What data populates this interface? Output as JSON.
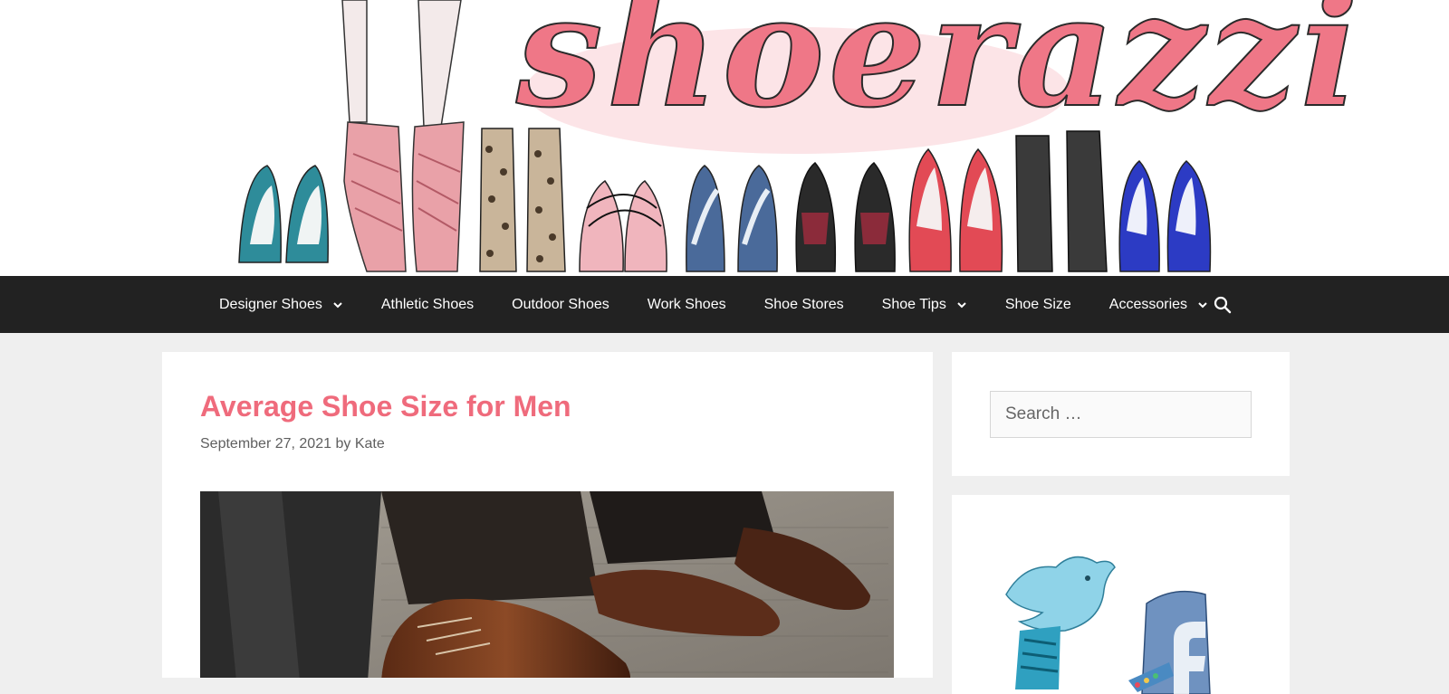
{
  "brand": {
    "logo_text": "shoerazzi",
    "accent_color": "#ef6b7c",
    "nav_bg_color": "#222222"
  },
  "nav": {
    "items": [
      {
        "label": "Designer Shoes",
        "has_dropdown": true
      },
      {
        "label": "Athletic Shoes",
        "has_dropdown": false
      },
      {
        "label": "Outdoor Shoes",
        "has_dropdown": false
      },
      {
        "label": "Work Shoes",
        "has_dropdown": false
      },
      {
        "label": "Shoe Stores",
        "has_dropdown": false
      },
      {
        "label": "Shoe Tips",
        "has_dropdown": true
      },
      {
        "label": "Shoe Size",
        "has_dropdown": false
      },
      {
        "label": "Accessories",
        "has_dropdown": true
      }
    ],
    "search_icon": "search-icon"
  },
  "post": {
    "title": "Average Shoe Size for Men",
    "date": "September 27, 2021",
    "by": "by",
    "author": "Kate"
  },
  "sidebar": {
    "search": {
      "placeholder": "Search …",
      "value": ""
    },
    "social_icons": [
      "twitter-icon",
      "facebook-icon"
    ]
  }
}
